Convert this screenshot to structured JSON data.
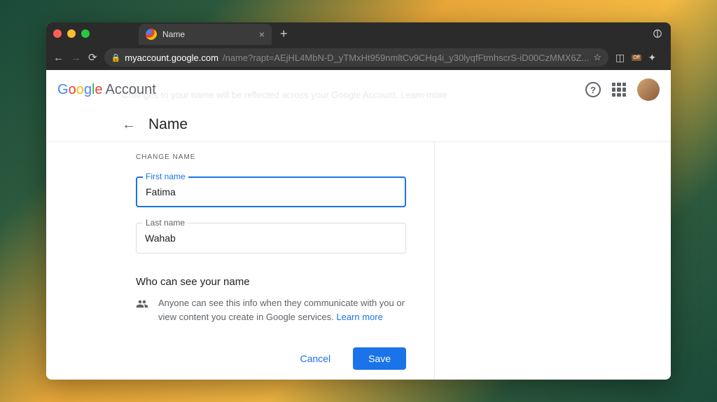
{
  "browser": {
    "tab_title": "Name",
    "url_domain": "myaccount.google.com",
    "url_path": "/name?rapt=AEjHL4MbN-D_yTMxHt959nmltCv9CHq4i_y30lyqfFtmhscrS-iD00CzMMX6Z...",
    "ext_off_label": "Off"
  },
  "header": {
    "logo_account": "Account",
    "ghost": "Changes to your name will be reflected across your Google Account. Learn more"
  },
  "page": {
    "title": "Name",
    "section_label": "CHANGE NAME",
    "first_name_label": "First name",
    "first_name_value": "Fatima",
    "last_name_label": "Last name",
    "last_name_value": "Wahab",
    "visibility_title": "Who can see your name",
    "visibility_text": "Anyone can see this info when they communicate with you or view content you create in Google services. ",
    "learn_more": "Learn more",
    "cancel": "Cancel",
    "save": "Save"
  }
}
